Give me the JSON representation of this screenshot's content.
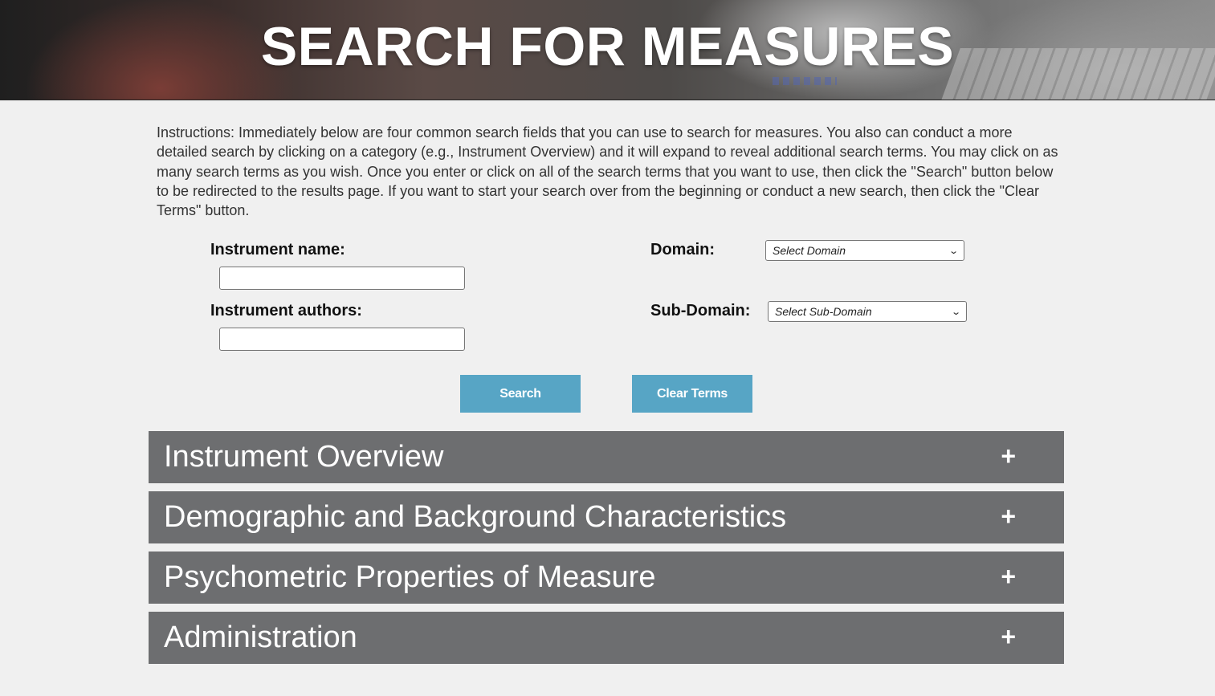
{
  "header": {
    "title": "SEARCH FOR MEASURES"
  },
  "instructions": "Instructions: Immediately below are four common search fields that you can use to search for measures. You also can conduct a more detailed search by clicking on a category (e.g., Instrument Overview) and it will expand to reveal additional search terms. You may click on as many search terms as you wish. Once you enter or click on all of the search terms that you want to use, then click the \"Search\" button below to be redirected to the results page. If you want to start your search over from the beginning or conduct a new search, then click the \"Clear Terms\" button.",
  "form": {
    "instrument_name_label": "Instrument name:",
    "instrument_name_value": "",
    "instrument_authors_label": "Instrument authors:",
    "instrument_authors_value": "",
    "domain_label": "Domain:",
    "domain_selected": "Select Domain",
    "subdomain_label": "Sub-Domain:",
    "subdomain_selected": "Select Sub-Domain",
    "chevron_icon": "chevron-down-icon"
  },
  "buttons": {
    "search_label": "Search",
    "clear_label": "Clear Terms",
    "color": "#57a5c5"
  },
  "accordion": {
    "color": "#6d6e70",
    "expand_icon": "plus-icon",
    "items": [
      {
        "label": "Instrument Overview",
        "icon": "+"
      },
      {
        "label": "Demographic and Background Characteristics",
        "icon": "+"
      },
      {
        "label": "Psychometric Properties of Measure",
        "icon": "+"
      },
      {
        "label": "Administration",
        "icon": "+"
      }
    ]
  }
}
